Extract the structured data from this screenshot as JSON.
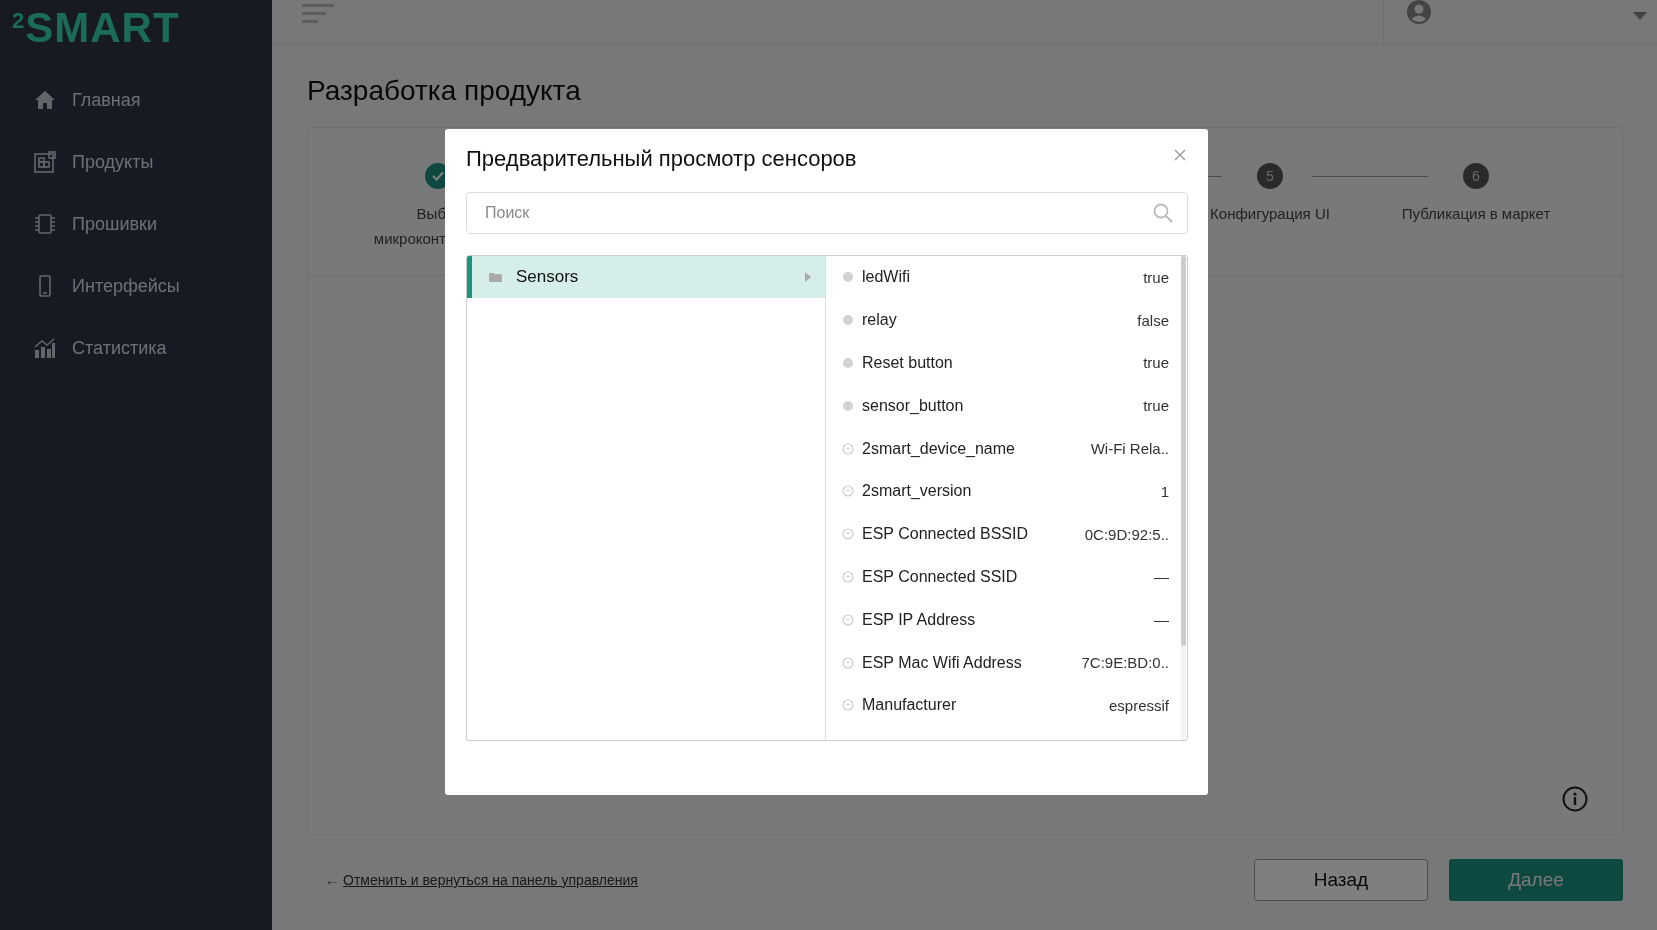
{
  "sidebar": {
    "logo": "$^{2}$SMART",
    "items": [
      {
        "kind": "home",
        "label": "Главная"
      },
      {
        "kind": "products",
        "label": "Продукты"
      },
      {
        "kind": "firmware",
        "label": "Прошивки"
      },
      {
        "kind": "phone",
        "label": "Интерфейсы"
      },
      {
        "kind": "stats",
        "label": "Статистика"
      }
    ]
  },
  "page": {
    "title": "Разработка продукта",
    "steps": [
      {
        "done": true,
        "label_lines": [
          "Выб",
          "микроконт"
        ]
      },
      {
        "done": false,
        "number": "5",
        "label_lines": [
          "Конфигурация UI"
        ]
      },
      {
        "done": false,
        "number": "6",
        "label_lines": [
          "Публикация в маркет"
        ]
      }
    ],
    "cancel_arrow": "←",
    "cancel_link": "Отменить и вернуться на панель управления",
    "buttons": [
      {
        "kind": "secondary",
        "label": "Назад"
      },
      {
        "kind": "primary",
        "label": "Далее"
      }
    ]
  },
  "modal": {
    "title": "Предварительный просмотр сенсоров",
    "search": {
      "placeholder": "Поиск"
    },
    "groups": [
      {
        "label": "Sensors",
        "selected": true
      }
    ],
    "rows": [
      {
        "kind": "sensor",
        "name": "ledWifi",
        "value": "true"
      },
      {
        "kind": "sensor",
        "name": "relay",
        "value": "false"
      },
      {
        "kind": "sensor",
        "name": "Reset button",
        "value": "true"
      },
      {
        "kind": "sensor",
        "name": "sensor_button",
        "value": "true"
      },
      {
        "kind": "option",
        "name": "2smart_device_name",
        "value": "Wi-Fi Rela.."
      },
      {
        "kind": "option",
        "name": "2smart_version",
        "value": "1"
      },
      {
        "kind": "option",
        "name": "ESP Connected BSSID",
        "value": "0C:9D:92:5.."
      },
      {
        "kind": "option",
        "name": "ESP Connected SSID",
        "value": "—"
      },
      {
        "kind": "option",
        "name": "ESP IP Address",
        "value": "—"
      },
      {
        "kind": "option",
        "name": "ESP Mac Wifi Address",
        "value": "7C:9E:BD:0.."
      },
      {
        "kind": "option",
        "name": "Manufacturer",
        "value": "espressif"
      }
    ]
  }
}
